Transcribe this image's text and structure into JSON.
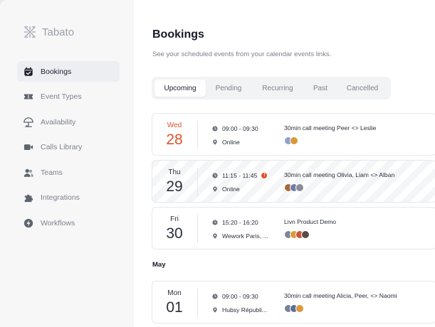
{
  "app": {
    "name": "Tabato"
  },
  "sidebar": {
    "items": [
      {
        "label": "Bookings",
        "icon": "calendar-check-icon",
        "active": true
      },
      {
        "label": "Event Types",
        "icon": "ticket-icon",
        "active": false
      },
      {
        "label": "Availability",
        "icon": "umbrella-icon",
        "active": false
      },
      {
        "label": "Calls Library",
        "icon": "video-icon",
        "active": false
      },
      {
        "label": "Teams",
        "icon": "users-icon",
        "active": false
      },
      {
        "label": "Integrations",
        "icon": "puzzle-icon",
        "active": false
      },
      {
        "label": "Workflows",
        "icon": "bolt-icon",
        "active": false
      }
    ]
  },
  "header": {
    "title": "Bookings",
    "subtitle": "See your scheduled events from your calendar events links."
  },
  "tabs": [
    {
      "label": "Upcoming",
      "active": true
    },
    {
      "label": "Pending",
      "active": false
    },
    {
      "label": "Recurring",
      "active": false
    },
    {
      "label": "Past",
      "active": false
    },
    {
      "label": "Cancelled",
      "active": false
    }
  ],
  "bookings": [
    {
      "dow": "Wed",
      "day": "28",
      "today": true,
      "time": "09:00 - 09:30",
      "location": "Online",
      "title": "30min call meeting Peer <> Leslie",
      "attendees": 2,
      "warning": false
    },
    {
      "dow": "Thu",
      "day": "29",
      "today": false,
      "time": "11:15 - 11:45",
      "location": "Online",
      "title": "30min call meeting Olivia, Liam <> Alban",
      "attendees": 3,
      "warning": true
    },
    {
      "dow": "Fri",
      "day": "30",
      "today": false,
      "time": "15:20 - 16:20",
      "location": "Wework Paris, ...",
      "title": "Livn Product Demo",
      "attendees": 4,
      "warning": false
    }
  ],
  "month_label": "May",
  "next_bookings": [
    {
      "dow": "Mon",
      "day": "01",
      "today": false,
      "time": "09:00 - 09:30",
      "location": "Hubsy Républi...",
      "title": "30min call meeting Alicia, Peer, <> Naomi",
      "attendees": 3,
      "warning": false
    }
  ],
  "colors": {
    "accent": "#e0522b",
    "active_bg": "#eceef1"
  }
}
